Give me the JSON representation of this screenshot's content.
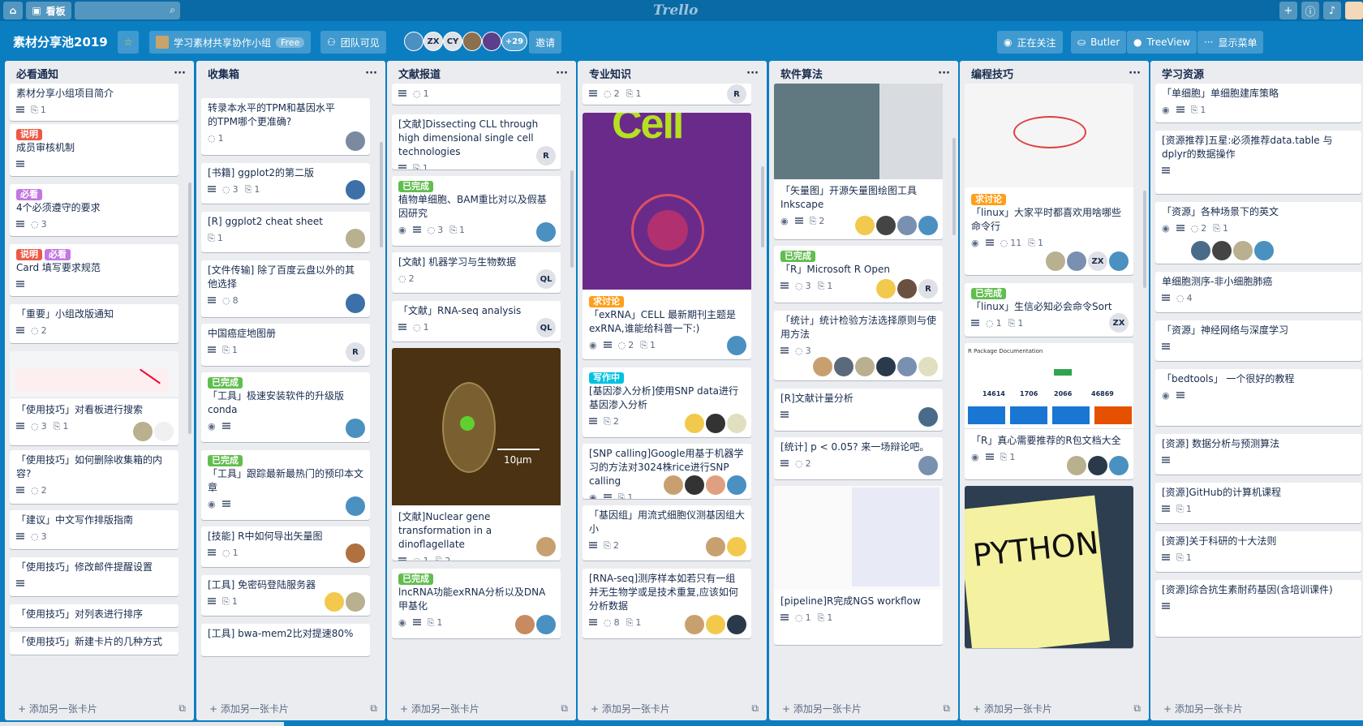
{
  "topbar": {
    "board_btn": "看板",
    "logo": "Trello"
  },
  "board": {
    "title": "素材分享池2019",
    "team": "学习素材共享协作小组",
    "team_badge": "Free",
    "visibility": "团队可见",
    "members": [
      "ZX",
      "CY"
    ],
    "more_members": "+29",
    "invite": "邀请",
    "watching": "正在关注",
    "butler": "Butler",
    "treeview": "TreeView",
    "show_menu": "显示菜单"
  },
  "add_card": "添加另一张卡片",
  "lists": [
    {
      "title": "必看通知",
      "cards": [
        {
          "title": "素材分享小组项目简介",
          "desc": true,
          "attach": "1"
        },
        {
          "labels": [
            {
              "text": "说明",
              "color": "#eb5a46"
            }
          ],
          "title": "成员审核机制",
          "desc": true
        },
        {
          "labels": [
            {
              "text": "必看",
              "color": "#c377e0"
            }
          ],
          "title": "4个必须遵守的要求",
          "desc": true,
          "comments": "3"
        },
        {
          "labels": [
            {
              "text": "说明",
              "color": "#eb5a46"
            },
            {
              "text": "必看",
              "color": "#c377e0"
            }
          ],
          "title": "Card 填写要求规范",
          "desc": true
        },
        {
          "title": "「重要」小组改版通知",
          "desc": true,
          "comments": "2"
        },
        {
          "title": "「使用技巧」对看板进行搜索",
          "desc": true,
          "comments": "3",
          "attach": "1"
        },
        {
          "title": "「使用技巧」如何删除收集箱的内容?",
          "desc": true,
          "comments": "2"
        },
        {
          "title": "「建议」中文写作排版指南",
          "desc": true,
          "comments": "3"
        },
        {
          "title": "「使用技巧」修改邮件提醒设置",
          "desc": true
        },
        {
          "title": "「使用技巧」对列表进行排序"
        },
        {
          "title": "「使用技巧」新建卡片的几种方式"
        }
      ]
    },
    {
      "title": "收集箱",
      "cards": [
        {
          "title": "转录本水平的TPM和基因水平的TPM哪个更准确?",
          "comments": "1"
        },
        {
          "title": "[书籍] ggplot2的第二版",
          "desc": true,
          "comments": "3",
          "attach": "1"
        },
        {
          "title": "[R] ggplot2 cheat sheet",
          "attach": "1"
        },
        {
          "title": "[文件传输] 除了百度云盘以外的其他选择",
          "desc": true,
          "comments": "8"
        },
        {
          "title": "中国癌症地图册",
          "desc": true,
          "attach": "1",
          "member": "R"
        },
        {
          "labels": [
            {
              "text": "已完成",
              "color": "#61bd4f"
            }
          ],
          "title": "「工具」极速安装软件的升级版conda"
        },
        {
          "labels": [
            {
              "text": "已完成",
              "color": "#61bd4f"
            }
          ],
          "title": "「工具」跟踪最新最热门的预印本文章"
        },
        {
          "title": "[技能] R中如何导出矢量图",
          "desc": true,
          "comments": "1"
        },
        {
          "title": "[工具] 免密码登陆服务器",
          "desc": true,
          "attach": "1"
        },
        {
          "title": "[工具] bwa-mem2比对提速80%"
        }
      ]
    },
    {
      "title": "文献报道",
      "cards": [
        {
          "comments": "1"
        },
        {
          "title": "[文献]Dissecting CLL through high dimensional single cell technologies",
          "desc": true,
          "attach": "1",
          "member": "R"
        },
        {
          "labels": [
            {
              "text": "已完成",
              "color": "#61bd4f"
            }
          ],
          "title": "植物单细胞、BAM重比对以及假基因研究",
          "comments": "3",
          "attach": "1"
        },
        {
          "title": "[文献] 机器学习与生物数据",
          "comments": "2",
          "member": "QL"
        },
        {
          "title": "「文献」RNA-seq analysis",
          "comments": "1",
          "member": "QL"
        },
        {
          "title": "[文献]Nuclear gene transformation in a dinoflagellate",
          "comments": "1",
          "attach": "2",
          "scale": "10µm"
        },
        {
          "labels": [
            {
              "text": "已完成",
              "color": "#61bd4f"
            }
          ],
          "title": "lncRNA功能exRNA分析以及DNA甲基化",
          "attach": "1"
        }
      ]
    },
    {
      "title": "专业知识",
      "cards": [
        {
          "comments": "2",
          "attach": "1",
          "member": "R"
        },
        {
          "labels": [
            {
              "text": "求讨论",
              "color": "#ff9f1a"
            }
          ],
          "title": "「exRNA」CELL 最新期刊主题是exRNA,谁能给科普一下:)",
          "comments": "2",
          "attach": "1",
          "cover": "Cell"
        },
        {
          "labels": [
            {
              "text": "写作中",
              "color": "#00c2e0"
            }
          ],
          "title": "[基因渗入分析]使用SNP data进行基因渗入分析",
          "attach": "2"
        },
        {
          "title": "[SNP calling]Google用基于机器学习的方法对3024株rice进行SNP calling",
          "attach": "1"
        },
        {
          "title": "「基因组」用流式细胞仪测基因组大小",
          "attach": "2"
        },
        {
          "title": "[RNA-seq]测序样本如若只有一组并无生物学或是技术重复,应该如何分析数据",
          "comments": "8",
          "attach": "1"
        }
      ]
    },
    {
      "title": "软件算法",
      "cards": [
        {
          "title": "「矢量图」开源矢量图绘图工具Inkscape",
          "attach": "2"
        },
        {
          "labels": [
            {
              "text": "已完成",
              "color": "#61bd4f"
            }
          ],
          "title": "「R」Microsoft R Open",
          "comments": "3",
          "attach": "1",
          "member": "R"
        },
        {
          "title": "「统计」统计检验方法选择原则与使用方法",
          "comments": "3"
        },
        {
          "title": "[R]文献计量分析"
        },
        {
          "title": "[统计] p < 0.05? 来一场辩论吧。",
          "comments": "2"
        },
        {
          "title": "[pipeline]R完成NGS workflow",
          "comments": "1",
          "attach": "1"
        }
      ]
    },
    {
      "title": "编程技巧",
      "cards": [
        {
          "labels": [
            {
              "text": "求讨论",
              "color": "#ff9f1a"
            }
          ],
          "title": "「linux」大家平时都喜欢用啥哪些命令行",
          "comments": "11",
          "attach": "1",
          "member": "ZX"
        },
        {
          "labels": [
            {
              "text": "已完成",
              "color": "#61bd4f"
            }
          ],
          "title": "「linux」生信必知必会命令Sort",
          "comments": "1",
          "attach": "1",
          "member": "ZX"
        },
        {
          "title": "「R」真心需要推荐的R包文档大全",
          "attach": "1",
          "cover_title": "R Package Documentation",
          "stats": [
            "14614",
            "1706",
            "2066",
            "46869"
          ]
        },
        {
          "cover": "PYTHON"
        }
      ]
    },
    {
      "title": "学习资源",
      "cards": [
        {
          "title": "「单细胞」单细胞建库策略",
          "attach": "1"
        },
        {
          "title": "[资源推荐]五星:必须推荐data.table 与 dplyr的数据操作"
        },
        {
          "title": "「资源」各种场景下的英文",
          "comments": "2",
          "attach": "1"
        },
        {
          "title": "单细胞测序-非小细胞肺癌",
          "comments": "4"
        },
        {
          "title": "「资源」神经网络与深度学习"
        },
        {
          "title": "「bedtools」 一个很好的教程"
        },
        {
          "title": "[资源] 数据分析与预测算法"
        },
        {
          "title": "[资源]GitHub的计算机课程",
          "attach": "1"
        },
        {
          "title": "[资源]关于科研的十大法则",
          "attach": "1"
        },
        {
          "title": "[资源]综合抗生素耐药基因(含培训课件)"
        }
      ]
    }
  ]
}
